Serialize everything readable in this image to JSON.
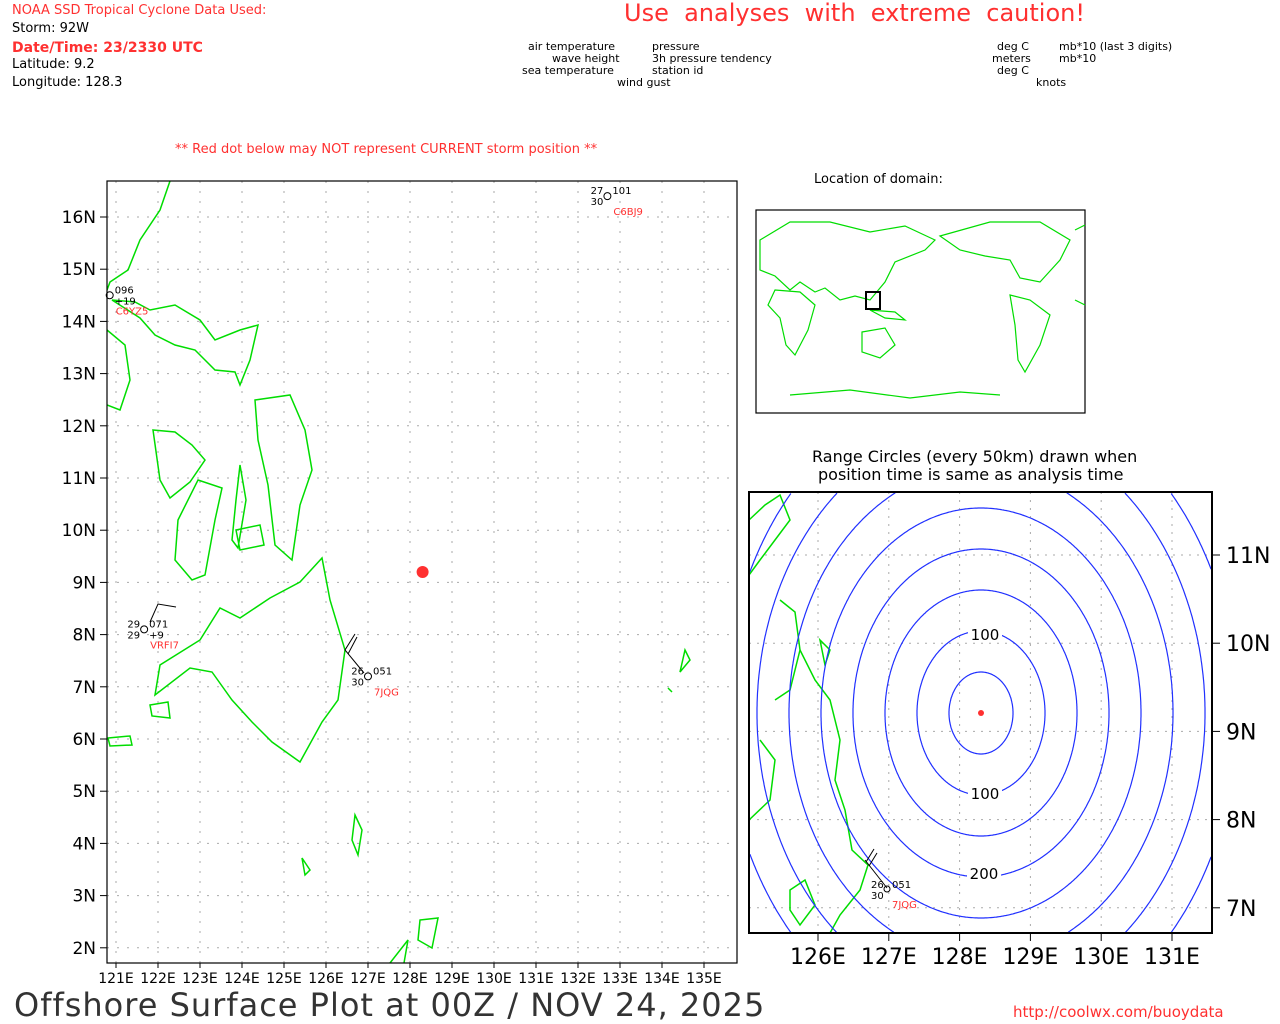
{
  "header": {
    "source_title": "NOAA SSD Tropical Cyclone Data Used:",
    "storm": "Storm: 92W",
    "datetime": "Date/Time: 23/2330 UTC",
    "latitude": "Latitude: 9.2",
    "longitude": "Longitude: 128.3",
    "caution": "Use  analyses  with  extreme  caution!",
    "red_dot_warning": "** Red dot below may NOT represent CURRENT storm position **"
  },
  "legend": {
    "left": [
      "air temperature",
      "wave height",
      "sea temperature",
      "wind gust"
    ],
    "right": [
      "pressure",
      "3h pressure tendency",
      "station id"
    ],
    "units_left": [
      "deg C",
      "meters",
      "deg C",
      "knots"
    ],
    "units_right": [
      "mb*10 (last 3 digits)",
      "mb*10"
    ]
  },
  "main_map": {
    "lat_labels": [
      "16N",
      "15N",
      "14N",
      "13N",
      "12N",
      "11N",
      "10N",
      "9N",
      "8N",
      "7N",
      "6N",
      "5N",
      "4N",
      "3N",
      "2N"
    ],
    "lat_values": [
      16,
      15,
      14,
      13,
      12,
      11,
      10,
      9,
      8,
      7,
      6,
      5,
      4,
      3,
      2
    ],
    "lon_labels": [
      "121E",
      "122E",
      "123E",
      "124E",
      "125E",
      "126E",
      "127E",
      "128E",
      "129E",
      "130E",
      "131E",
      "132E",
      "133E",
      "134E",
      "135E"
    ],
    "lon_values": [
      121,
      122,
      123,
      124,
      125,
      126,
      127,
      128,
      129,
      130,
      131,
      132,
      133,
      134,
      135
    ],
    "storm": {
      "lat": 9.2,
      "lon": 128.3,
      "color": "#ff3030"
    },
    "stations": [
      {
        "id": "C6YZ5",
        "lat": 14.5,
        "lon": 120.85,
        "tl": "",
        "bl": "",
        "tr": "096",
        "br": "+19"
      },
      {
        "id": "VRFI7",
        "lat": 8.1,
        "lon": 121.67,
        "tl": "29",
        "bl": "29",
        "tr": "071",
        "br": "+9"
      },
      {
        "id": "7JQG",
        "lat": 7.2,
        "lon": 127.0,
        "tl": "26",
        "bl": "30",
        "tr": "051",
        "br": ""
      },
      {
        "id": "C6BJ9",
        "lat": 16.4,
        "lon": 132.7,
        "tl": "27",
        "bl": "30",
        "tr": "101",
        "br": ""
      }
    ]
  },
  "domain_map": {
    "title": "Location of domain:"
  },
  "range_map": {
    "title_line1": "Range Circles (every 50km) drawn when",
    "title_line2": "position time is same as analysis time",
    "lat_labels": [
      "11N",
      "10N",
      "9N",
      "8N",
      "7N"
    ],
    "lat_values": [
      11,
      10,
      9,
      8,
      7
    ],
    "lon_labels": [
      "126E",
      "127E",
      "128E",
      "129E",
      "130E",
      "131E"
    ],
    "lon_values": [
      126,
      127,
      128,
      129,
      130,
      131
    ],
    "ring_labels": [
      "100",
      "100",
      "200"
    ],
    "station": {
      "id": "7JQG",
      "tl": "26",
      "bl": "30",
      "tr": "051"
    }
  },
  "footer": {
    "title": "Offshore Surface Plot at 00Z / NOV 24, 2025",
    "url": "http://coolwx.com/buoydata"
  },
  "colors": {
    "land": "#00dd00",
    "rings": "#2030ff",
    "accent": "#ff3030",
    "grid": "#aaaaaa"
  }
}
